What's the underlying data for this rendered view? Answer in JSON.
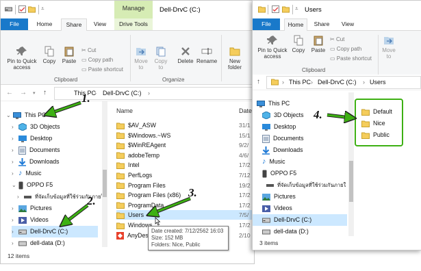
{
  "left_window": {
    "manage_tab": "Manage",
    "title": "Dell-DrvC (C:)",
    "tabs": [
      "File",
      "Home",
      "Share",
      "View",
      "Drive Tools"
    ],
    "ribbon": {
      "pin": "Pin to Quick access",
      "copy": "Copy",
      "paste": "Paste",
      "cut": "Cut",
      "copy_path": "Copy path",
      "paste_shortcut": "Paste shortcut",
      "move_to": "Move to",
      "copy_to": "Copy to",
      "delete": "Delete",
      "rename": "Rename",
      "new_folder": "New folder",
      "clipboard_group": "Clipboard",
      "organize_group": "Organize"
    },
    "address": [
      "This PC",
      "Dell-DrvC (C:)"
    ],
    "nav": {
      "this_pc": "This PC",
      "objects3d": "3D Objects",
      "desktop": "Desktop",
      "documents": "Documents",
      "downloads": "Downloads",
      "music": "Music",
      "oppo": "OPPO F5",
      "thai": "ที่จัดเก็บข้อมูลที่ใช้ร่วมกันภายใ",
      "pictures": "Pictures",
      "videos": "Videos",
      "dellc": "Dell-DrvC (C:)",
      "delld": "dell-data (D:)"
    },
    "columns": {
      "name": "Name",
      "date": "Date"
    },
    "files": [
      {
        "name": "$AV_ASW",
        "date": "31/1"
      },
      {
        "name": "$Windows.~WS",
        "date": "15/1"
      },
      {
        "name": "$WinREAgent",
        "date": "9/2/"
      },
      {
        "name": "adobeTemp",
        "date": "4/6/"
      },
      {
        "name": "Intel",
        "date": "17/2"
      },
      {
        "name": "PerfLogs",
        "date": "7/12"
      },
      {
        "name": "Program Files",
        "date": "19/2"
      },
      {
        "name": "Program Files (x86)",
        "date": "17/2"
      },
      {
        "name": "ProgramData",
        "date": "17/2"
      },
      {
        "name": "Users",
        "date": "7/5/"
      },
      {
        "name": "Windows",
        "date": "17/2"
      },
      {
        "name": "AnyDesk",
        "date": "2/10"
      }
    ],
    "status": "12 items",
    "tooltip": {
      "line1": "Date created: 7/12/2562 16:03",
      "line2": "Size: 152 MB",
      "line3": "Folders: Nice, Public"
    }
  },
  "right_window": {
    "title": "Users",
    "tabs": [
      "File",
      "Home",
      "Share",
      "View"
    ],
    "ribbon": {
      "pin": "Pin to Quick access",
      "copy": "Copy",
      "paste": "Paste",
      "cut": "Cut",
      "copy_path": "Copy path",
      "paste_shortcut": "Paste shortcut",
      "move_to": "Move to",
      "clipboard_group": "Clipboard"
    },
    "address": [
      "This PC",
      "Dell-DrvC (C:)",
      "Users"
    ],
    "nav": {
      "this_pc": "This PC",
      "objects3d": "3D Objects",
      "desktop": "Desktop",
      "documents": "Documents",
      "downloads": "Downloads",
      "music": "Music",
      "oppo": "OPPO F5",
      "thai": "ที่จัดเก็บข้อมูลที่ใช้ร่วมกันภายใ",
      "pictures": "Pictures",
      "videos": "Videos",
      "dellc": "Dell-DrvC (C:)",
      "delld": "dell-data (D:)"
    },
    "folders": [
      "Default",
      "Nice",
      "Public"
    ],
    "status": "3 items"
  },
  "callouts": [
    "1.",
    "2.",
    "3.",
    "4."
  ],
  "colors": {
    "accent": "#1979ca",
    "manage": "#d6ecb4",
    "selection": "#cce8ff",
    "arrow": "#3db013",
    "folder": "#f5cd5c"
  }
}
